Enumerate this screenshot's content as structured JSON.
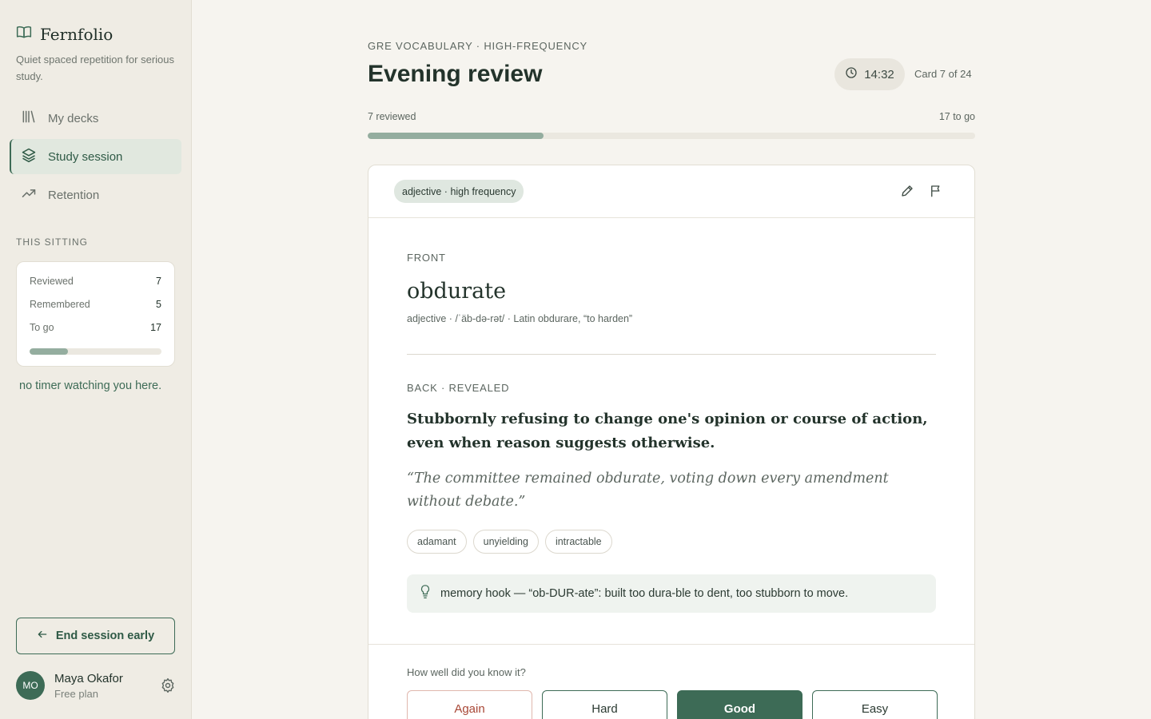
{
  "app": {
    "name": "Fernfolio",
    "tagline": "Quiet spaced repetition for serious study."
  },
  "nav": [
    {
      "label": "My decks",
      "icon": "library-icon",
      "active": false
    },
    {
      "label": "Study session",
      "icon": "layers-icon",
      "active": true
    },
    {
      "label": "Retention",
      "icon": "trend-up-icon",
      "active": false
    }
  ],
  "sitting": {
    "label": "THIS SITTING",
    "rows": [
      {
        "label": "Reviewed",
        "value": "7"
      },
      {
        "label": "Remembered",
        "value": "5"
      },
      {
        "label": "To go",
        "value": "17"
      }
    ],
    "progress_fraction": 0.29,
    "note": "no timer watching you here."
  },
  "end_session_label": "End session early",
  "user": {
    "initials": "MO",
    "name": "Maya Okafor",
    "plan": "Free plan"
  },
  "session": {
    "eyebrow": "GRE VOCABULARY · HIGH-FREQUENCY",
    "title": "Evening review",
    "timer": "14:32",
    "card_count": "Card 7 of 24",
    "reviewed_label": "7 reviewed",
    "togo_label": "17 to go",
    "progress_fraction": 0.29
  },
  "card": {
    "chip": "adjective · high frequency",
    "front_label": "FRONT",
    "word": "obdurate",
    "meta": "adjective · /ˈäb-də-rət/ · Latin obdurare, “to harden”",
    "back_label": "BACK · REVEALED",
    "definition": "Stubbornly refusing to change one's opinion or course of action, even when reason suggests otherwise.",
    "example": "“The committee remained obdurate, voting down every amendment without debate.”",
    "synonyms": [
      "adamant",
      "unyielding",
      "intractable"
    ],
    "memory_hook": "memory hook — “ob-DUR-ate”: built too dura-ble to dent, too stubborn to move."
  },
  "rating": {
    "question": "How well did you know it?",
    "buttons": [
      "Again",
      "Hard",
      "Good",
      "Easy"
    ]
  },
  "colors": {
    "accent": "#3d6b56",
    "again": "#a84736",
    "progress": "#94ad9f"
  }
}
